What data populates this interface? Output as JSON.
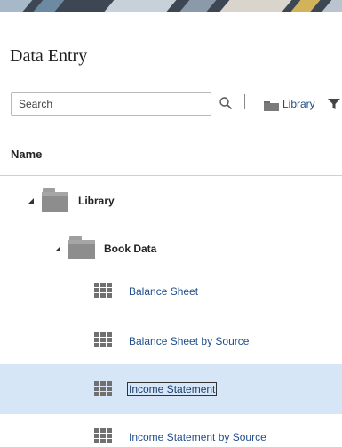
{
  "page": {
    "title": "Data Entry"
  },
  "toolbar": {
    "search_placeholder": "Search",
    "search_icon": "magnifier-icon",
    "library_label": "Library",
    "filter_icon": "filter-funnel-icon"
  },
  "table": {
    "column_name": "Name"
  },
  "tree": {
    "root": {
      "label": "Library",
      "icon": "folder-icon",
      "expanded": true
    },
    "child": {
      "label": "Book Data",
      "icon": "folder-icon",
      "expanded": true
    },
    "forms": [
      {
        "label": "Balance Sheet",
        "icon": "grid-form-icon",
        "selected": false
      },
      {
        "label": "Balance Sheet by Source",
        "icon": "grid-form-icon",
        "selected": false
      },
      {
        "label": "Income Statement",
        "icon": "grid-form-icon",
        "selected": true
      },
      {
        "label": "Income Statement by Source",
        "icon": "grid-form-icon",
        "selected": false
      }
    ]
  },
  "colors": {
    "link": "#1f4e8a",
    "selected_row": "#d6e6f6",
    "folder": "#9e9e9e",
    "grid_icon": "#707070"
  }
}
